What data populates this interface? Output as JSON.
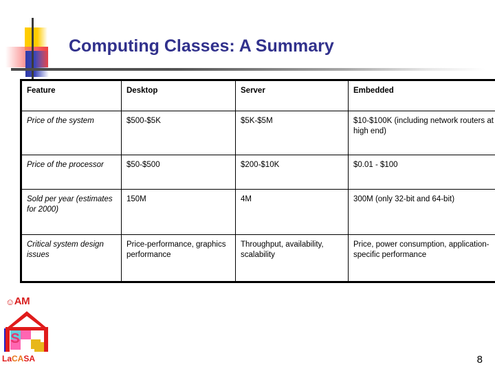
{
  "slide": {
    "title": "Computing Classes: A Summary",
    "page_number": "8",
    "title_color": "#31318C"
  },
  "ornament": {
    "yellow": "#FFCC00",
    "red": "#F04040",
    "blue": "#2F3BA8",
    "line": "#4a4a4a"
  },
  "table": {
    "headers": [
      "Feature",
      "Desktop",
      "Server",
      "Embedded"
    ],
    "rows": [
      {
        "feature": "Price of the system",
        "desktop": "$500-$5K",
        "server": "$5K-$5M",
        "embedded": "$10-$100K (including network routers at high end)"
      },
      {
        "feature": "Price of the processor",
        "desktop": "$50-$500",
        "server": "$200-$10K",
        "embedded": "$0.01 - $100"
      },
      {
        "feature": "Sold per year (estimates for 2000)",
        "desktop": "150M",
        "server": "4M",
        "embedded": "300M\n(only 32-bit and 64-bit)"
      },
      {
        "feature": "Critical system design issues",
        "desktop": "Price-performance, graphics performance",
        "server": "Throughput, availability, scalability",
        "embedded": "Price, power consumption, application-specific performance"
      }
    ]
  },
  "logo": {
    "am_icon": "☺",
    "am_text": "AM",
    "lacasa_la": "La",
    "lacasa_ca": "CA",
    "lacasa_sa": "SA",
    "house_color": "#E01B1B",
    "blue": "#2222C8",
    "pink": "#FF66B2",
    "cyan": "#66CCDD",
    "gold": "#E8B71B"
  }
}
